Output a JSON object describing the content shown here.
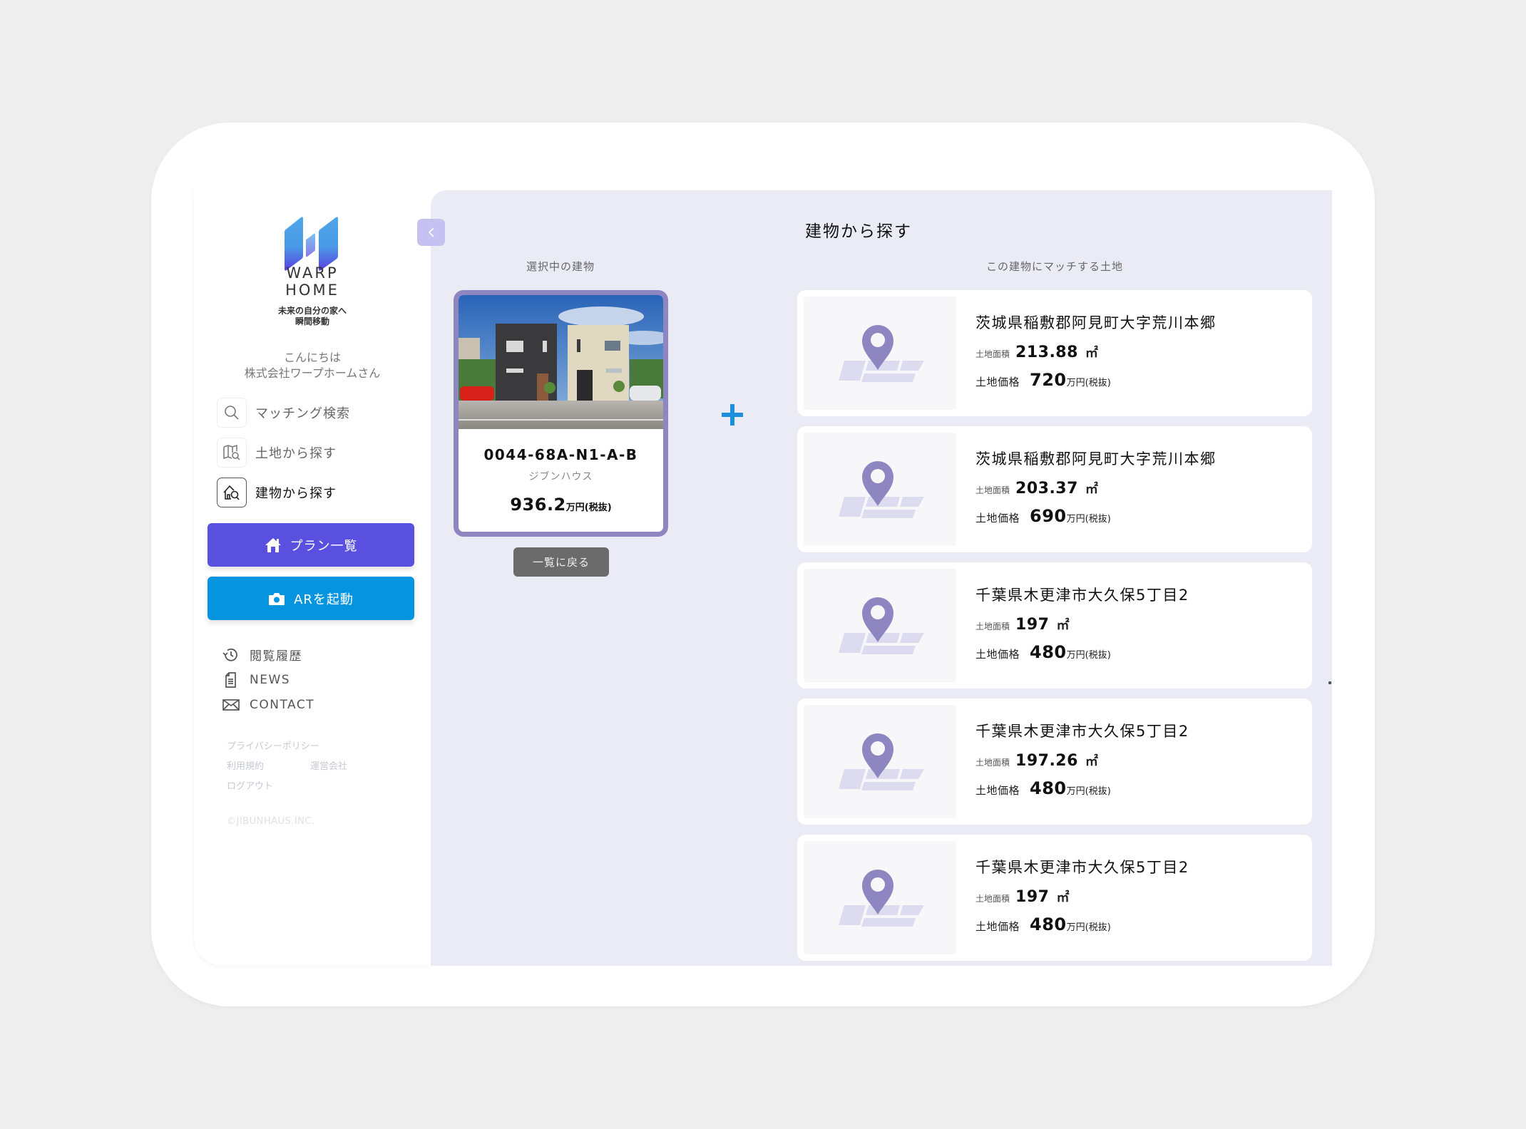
{
  "brand": {
    "logo_line1": "WARP",
    "logo_line2": "HOME",
    "tagline_line1": "未来の自分の家へ",
    "tagline_line2": "瞬間移動",
    "logo_colors": [
      "#4fa6e8",
      "#5a45e0"
    ]
  },
  "greeting": {
    "line1": "こんにちは",
    "line2": "株式会社ワープホームさん"
  },
  "sidebar": {
    "nav_items": [
      {
        "label": "マッチング検索",
        "icon": "search-icon",
        "active": false
      },
      {
        "label": "土地から探す",
        "icon": "map-search-icon",
        "active": false
      },
      {
        "label": "建物から探す",
        "icon": "house-search-icon",
        "active": true
      }
    ],
    "plan_button": {
      "label": "プラン一覧",
      "icon": "house-icon",
      "color": "#5a50e0"
    },
    "ar_button": {
      "label": "ARを起動",
      "icon": "camera-icon",
      "color": "#0595e0"
    },
    "sub_items": [
      {
        "label": "閲覧履歴",
        "icon": "history-icon"
      },
      {
        "label": "NEWS",
        "icon": "document-icon"
      },
      {
        "label": "CONTACT",
        "icon": "mail-icon"
      }
    ],
    "footer_links": {
      "privacy": "プライバシーポリシー",
      "terms": "利用規約",
      "company": "運営会社",
      "logout": "ログアウト"
    },
    "copyright": "©JIBUNHAUS.INC."
  },
  "main": {
    "title": "建物から探す",
    "selected_label": "選択中の建物",
    "matching_label": "この建物にマッチする土地",
    "building": {
      "id": "0044-68A-N1-A-B",
      "maker": "ジブンハウス",
      "price": "936.2",
      "price_unit": "万円(税抜)"
    },
    "back_button": "一覧に戻る",
    "plus_icon": "plus-icon",
    "accent_border": "#8e86c0",
    "land_area_label": "土地面積",
    "land_price_label": "土地価格",
    "area_unit": "㎡",
    "price_unit": "万円(税抜)",
    "lands": [
      {
        "address": "茨城県稲敷郡阿見町大字荒川本郷",
        "area": "213.88",
        "price": "720"
      },
      {
        "address": "茨城県稲敷郡阿見町大字荒川本郷",
        "area": "203.37",
        "price": "690"
      },
      {
        "address": "千葉県木更津市大久保5丁目2",
        "area": "197",
        "price": "480"
      },
      {
        "address": "千葉県木更津市大久保5丁目2",
        "area": "197.26",
        "price": "480"
      },
      {
        "address": "千葉県木更津市大久保5丁目2",
        "area": "197",
        "price": "480"
      }
    ]
  }
}
